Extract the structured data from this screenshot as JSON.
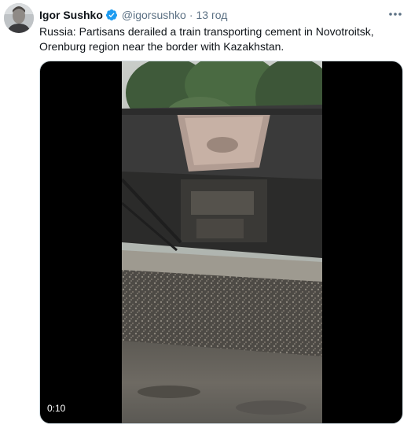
{
  "tweet": {
    "author_name": "Igor Sushko",
    "author_handle": "@igorsushko",
    "separator": "·",
    "time": "13 год",
    "text": "Russia: Partisans derailed a train transporting cement in Novotroitsk,\nOrenburg region near the border with Kazakhstan.",
    "verified": true
  },
  "media": {
    "duration_label": "0:10"
  },
  "icons": {
    "verified": "verified-badge-icon",
    "more": "more-options-icon"
  },
  "colors": {
    "verified_blue": "#1d9bf0",
    "secondary_text": "#5b7083",
    "primary_text": "#0f1419"
  }
}
